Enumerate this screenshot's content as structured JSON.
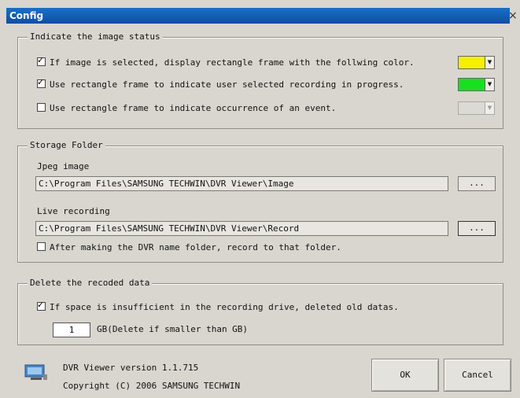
{
  "window": {
    "title": "Config",
    "close_icon": "close-icon"
  },
  "image_status": {
    "legend": "Indicate the image status",
    "items": [
      {
        "label": "If image is selected, display rectangle frame with the follwing color.",
        "checked": true,
        "color": "#f6f000",
        "enabled": true
      },
      {
        "label": "Use rectangle frame to indicate user selected recording in progress.",
        "checked": true,
        "color": "#19e01e",
        "enabled": true
      },
      {
        "label": "Use rectangle frame to indicate occurrence of an event.",
        "checked": false,
        "color": "#dcdad4",
        "enabled": false
      }
    ]
  },
  "storage": {
    "legend": "Storage Folder",
    "jpeg_label": "Jpeg image",
    "jpeg_path": "C:\\Program Files\\SAMSUNG TECHWIN\\DVR Viewer\\Image",
    "live_label": "Live recording",
    "live_path": "C:\\Program Files\\SAMSUNG TECHWIN\\DVR Viewer\\Record",
    "browse_label": "...",
    "folder_checkbox": {
      "label": "After making the DVR name folder, record to that folder.",
      "checked": false
    }
  },
  "delete": {
    "legend": "Delete the recoded data",
    "checkbox": {
      "label": "If space is insufficient in the recording drive, deleted old datas.",
      "checked": true
    },
    "gb_value": "1",
    "gb_suffix": "GB(Delete if smaller than GB)"
  },
  "footer": {
    "version": "DVR Viewer version 1.1.715",
    "copyright": "Copyright (C) 2006 SAMSUNG TECHWIN",
    "ok_label": "OK",
    "cancel_label": "Cancel",
    "app_icon": "monitor-icon"
  }
}
